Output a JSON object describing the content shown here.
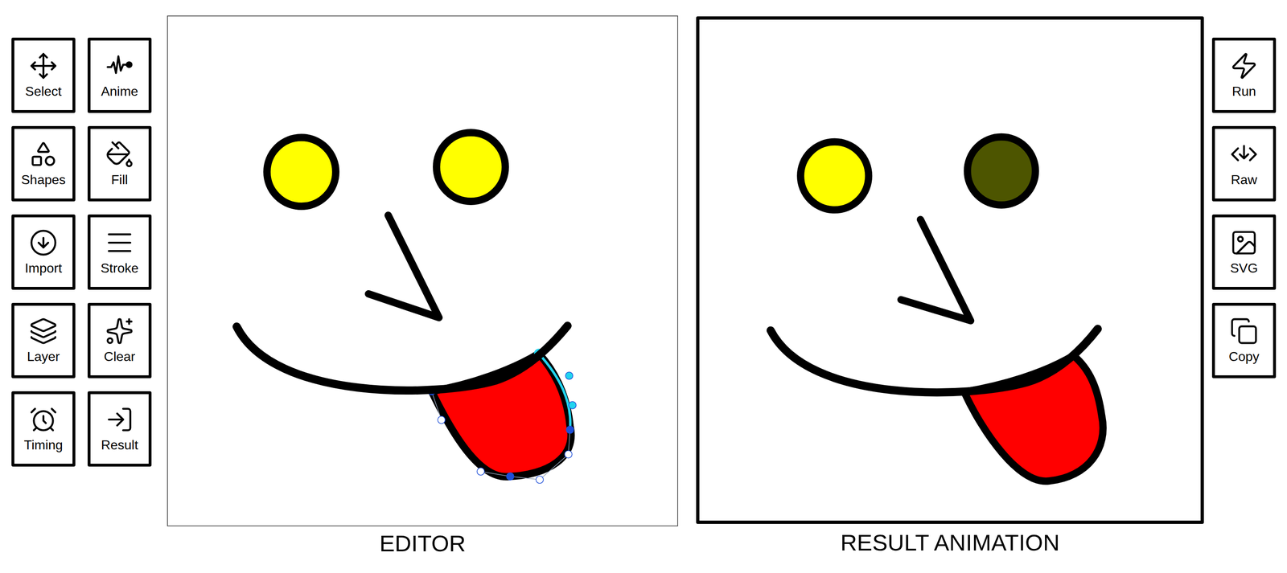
{
  "left_toolbar": [
    {
      "label": "Select",
      "icon": "move"
    },
    {
      "label": "Anime",
      "icon": "wave"
    },
    {
      "label": "Shapes",
      "icon": "shapes"
    },
    {
      "label": "Fill",
      "icon": "bucket"
    },
    {
      "label": "Import",
      "icon": "import"
    },
    {
      "label": "Stroke",
      "icon": "lines"
    },
    {
      "label": "Layer",
      "icon": "layers"
    },
    {
      "label": "Clear",
      "icon": "sparkles"
    },
    {
      "label": "Timing",
      "icon": "alarm"
    },
    {
      "label": "Result",
      "icon": "enter"
    }
  ],
  "right_toolbar": [
    {
      "label": "Run",
      "icon": "bolt"
    },
    {
      "label": "Raw",
      "icon": "raw"
    },
    {
      "label": "SVG",
      "icon": "image"
    },
    {
      "label": "Copy",
      "icon": "copy"
    }
  ],
  "editor": {
    "label": "EDITOR",
    "shapes": [
      {
        "kind": "eye",
        "color": "#ffff00",
        "selected": false
      },
      {
        "kind": "eye",
        "color": "#ffff00",
        "selected": false
      },
      {
        "kind": "nose",
        "color": "#000000",
        "selected": false
      },
      {
        "kind": "tongue",
        "color": "#ff0000",
        "selected": true
      },
      {
        "kind": "mouth",
        "color": "#000000",
        "selected": false
      }
    ]
  },
  "result": {
    "label": "RESULT ANIMATION",
    "shapes": [
      {
        "kind": "eye",
        "color": "#ffff00"
      },
      {
        "kind": "eye",
        "color": "#4d5500"
      },
      {
        "kind": "nose",
        "color": "#000000"
      },
      {
        "kind": "tongue",
        "color": "#ff0000"
      },
      {
        "kind": "mouth",
        "color": "#000000"
      }
    ]
  }
}
